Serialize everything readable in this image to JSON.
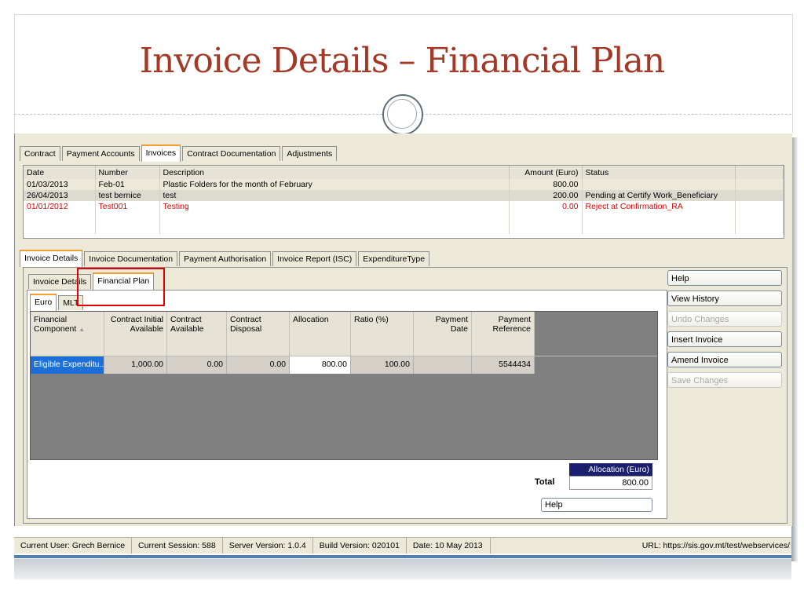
{
  "slide": {
    "title": "Invoice Details – Financial Plan"
  },
  "main_tabs": [
    "Contract",
    "Payment Accounts",
    "Invoices",
    "Contract Documentation",
    "Adjustments"
  ],
  "invoices": {
    "columns": [
      "Date",
      "Number",
      "Description",
      "Amount (Euro)",
      "Status"
    ],
    "rows": [
      {
        "date": "01/03/2013",
        "number": "Feb-01",
        "description": "Plastic Folders for the month of February",
        "amount": "800.00",
        "status": ""
      },
      {
        "date": "26/04/2013",
        "number": "test bernice",
        "description": "test",
        "amount": "200.00",
        "status": "Pending at Certify Work_Beneficiary"
      },
      {
        "date": "01/01/2012",
        "number": "Test001",
        "description": "Testing",
        "amount": "0.00",
        "status": "Reject at Confirmation_RA"
      }
    ]
  },
  "detail_tabs": [
    "Invoice Details",
    "Invoice Documentation",
    "Payment Authorisation",
    "Invoice Report (ISC)",
    "ExpenditureType"
  ],
  "sub_tabs": [
    "Invoice Details",
    "Financial Plan"
  ],
  "currency_tabs": [
    "Euro",
    "MLT"
  ],
  "financial_plan": {
    "columns": [
      "Financial Component",
      "Contract Initial Available",
      "Contract Available",
      "Contract Disposal",
      "Allocation",
      "Ratio (%)",
      "Payment Date",
      "Payment Reference"
    ],
    "row": {
      "component": "Eligible Expenditu...",
      "initial": "1,000.00",
      "available": "0.00",
      "disposal": "0.00",
      "allocation": "800.00",
      "ratio": "100.00",
      "date": "",
      "reference": "5544434"
    }
  },
  "totals": {
    "header": "Allocation (Euro)",
    "label": "Total",
    "value": "800.00",
    "help": "Help"
  },
  "side_buttons": {
    "help": "Help",
    "view_history": "View History",
    "undo": "Undo Changes",
    "insert": "Insert Invoice",
    "amend": "Amend Invoice",
    "save": "Save Changes"
  },
  "status_bar": {
    "user": "Current User: Grech Bernice",
    "session": "Current Session: 588",
    "server": "Server Version: 1.0.4",
    "build": "Build Version: 020101",
    "date": "Date: 10 May 2013",
    "url": "URL: https://sis.gov.mt/test/webservices/"
  },
  "colors": {
    "title": "#a33a28",
    "highlight_box": "#e00000",
    "selected_cell": "#1c6fd6",
    "totals_header": "#1a1f6e"
  }
}
